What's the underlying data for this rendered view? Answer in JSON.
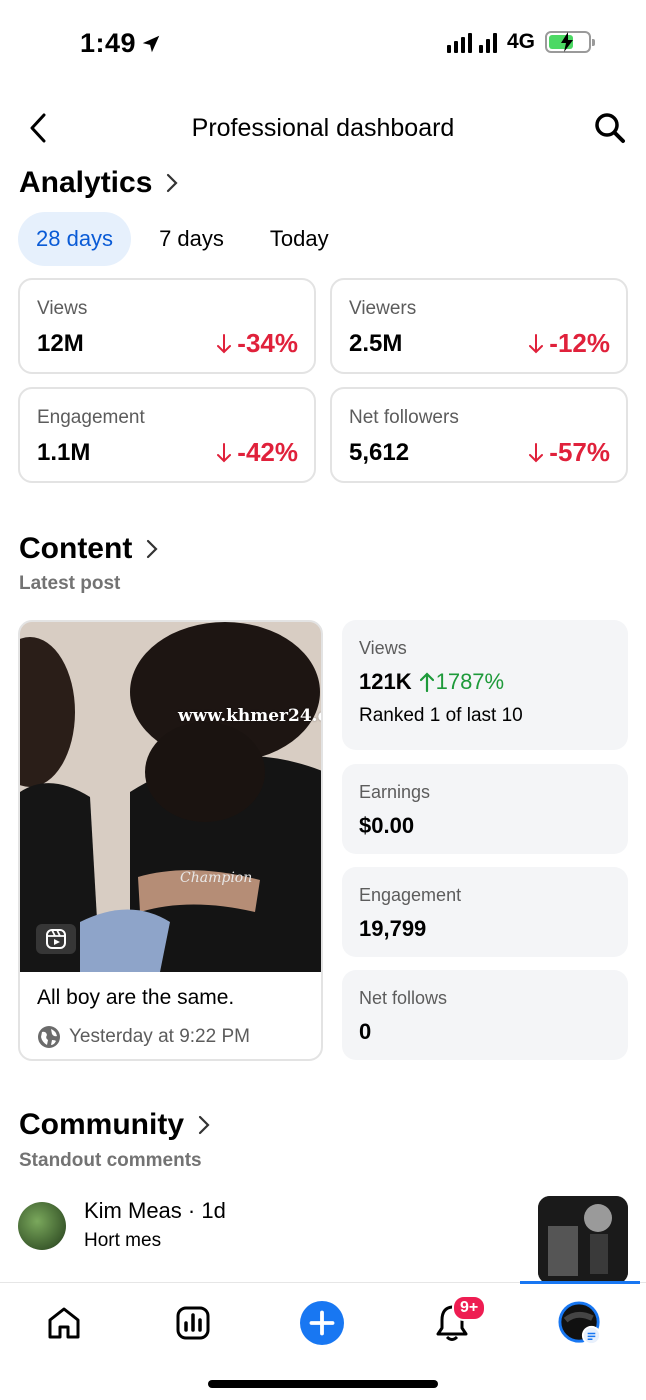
{
  "status_bar": {
    "time": "1:49",
    "network": "4G"
  },
  "header": {
    "title": "Professional dashboard"
  },
  "analytics": {
    "title": "Analytics",
    "tabs": [
      {
        "label": "28 days",
        "active": true
      },
      {
        "label": "7 days",
        "active": false
      },
      {
        "label": "Today",
        "active": false
      }
    ],
    "metrics": [
      {
        "label": "Views",
        "value": "12M",
        "change": "-34%"
      },
      {
        "label": "Viewers",
        "value": "2.5M",
        "change": "-12%"
      },
      {
        "label": "Engagement",
        "value": "1.1M",
        "change": "-42%"
      },
      {
        "label": "Net followers",
        "value": "5,612",
        "change": "-57%"
      }
    ]
  },
  "content": {
    "title": "Content",
    "subtitle": "Latest post",
    "post": {
      "caption": "All boy are the same.",
      "time": "Yesterday at 9:22 PM",
      "watermark": "www.khmer24.c"
    },
    "stats": [
      {
        "label": "Views",
        "value": "121K",
        "change": "1787%",
        "extra": "Ranked 1 of last 10"
      },
      {
        "label": "Earnings",
        "value": "$0.00"
      },
      {
        "label": "Engagement",
        "value": "19,799"
      },
      {
        "label": "Net follows",
        "value": "0"
      }
    ]
  },
  "community": {
    "title": "Community",
    "subtitle": "Standout comments",
    "comment": {
      "user": "Kim Meas · 1d",
      "text": "Hort mes"
    }
  },
  "nav": {
    "notifications_badge": "9+"
  },
  "colors": {
    "accent": "#1877f2",
    "negative": "#e0213b",
    "positive": "#1e9a3a"
  }
}
